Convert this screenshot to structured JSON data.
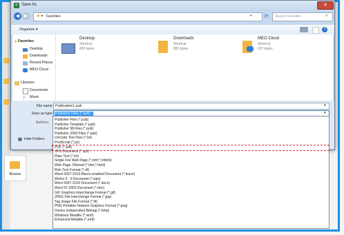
{
  "background": {
    "browse_label": "Browse"
  },
  "dialog": {
    "title": "Save As",
    "close_glyph": "✕",
    "breadcrumb": "Favorites",
    "search_placeholder": "Search Favorites",
    "toolbar": {
      "organize_label": "Organize ▾",
      "help_glyph": "?"
    },
    "nav": {
      "favorites": "Favorites",
      "items": [
        "Desktop",
        "Downloads",
        "Recent Places",
        "MEO Cloud"
      ],
      "libraries": "Libraries",
      "library_items": [
        "Documents",
        "Music"
      ]
    },
    "files": [
      {
        "name": "Desktop",
        "type": "Shortcut",
        "size": "435 bytes"
      },
      {
        "name": "Downloads",
        "type": "Shortcut",
        "size": "882 bytes"
      },
      {
        "name": "MEO Cloud",
        "type": "Shortcut",
        "size": "627 bytes"
      }
    ],
    "file_name_label": "File name:",
    "file_name_value": "Publication1.pub",
    "save_type_label": "Save as type:",
    "save_type_value": "Publisher Files (*.pub)",
    "authors_label": "Authors:",
    "hide_folders_label": "Hide Folders"
  },
  "dropdown_options": [
    "Publisher Files (*.pub)",
    "Publisher Template (*.pub)",
    "Publisher 98 Files (*.pub)",
    "Publisher 2000 Files (*.pub)",
    "Unicode Text Files (*.txt)",
    "PostScript (*.ps)",
    "PDF (*.pdf)",
    "XPS Document (*.xps)",
    "Plain Text (*.txt)",
    "Single File Web Page (*.mht;*.mhtml)",
    "Web Page, Filtered (*.htm;*.html)",
    "Rich Text Format (*.rtf)",
    "Word 2007-2013 Macro-enabled Document (*.docm)",
    "Works 6 - 9 Document (*.wps)",
    "Word 2007-2013 Document (*.docx)",
    "Word 97-2003 Document (*.doc)",
    "GIF Graphics Interchange Format (*.gif)",
    "JPEG File Interchange Format (*.jpg)",
    "Tag Image File Format (*.tif)",
    "PNG Portable Network Graphics Format (*.png)",
    "Device Independent Bitmap (*.bmp)",
    "Windows Metafile (*.wmf)",
    "Enhanced Metafile (*.emf)"
  ]
}
